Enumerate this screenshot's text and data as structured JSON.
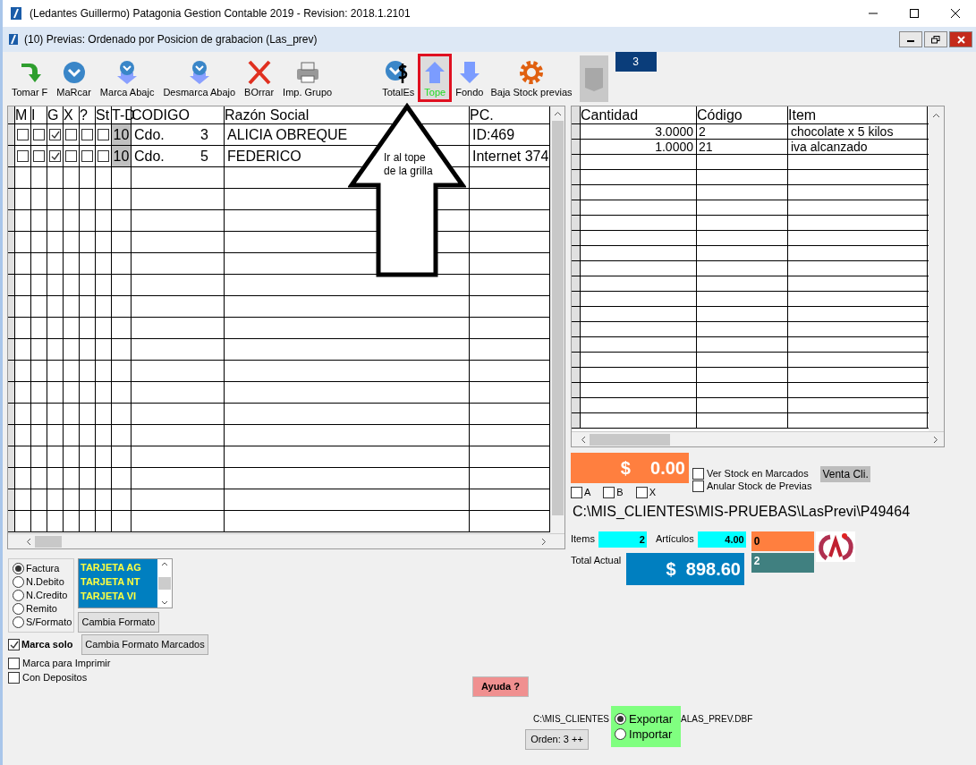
{
  "window": {
    "title": "(Ledantes Guillermo) Patagonia Gestion Contable 2019 - Revision: 2018.1.2101"
  },
  "child_window": {
    "title": "(10) Previas: Ordenado por Posicion de grabacion (Las_prev)"
  },
  "toolbar": [
    {
      "label": "Tomar F",
      "kind": "turn",
      "selected": false
    },
    {
      "label": "MaRcar",
      "kind": "check",
      "selected": false
    },
    {
      "label": "Marca Abajc",
      "kind": "checkdown",
      "selected": false
    },
    {
      "label": "Desmarca Abajo",
      "kind": "checkdown",
      "selected": false
    },
    {
      "label": "BOrrar",
      "kind": "delete",
      "selected": false
    },
    {
      "label": "Imp. Grupo",
      "kind": "print",
      "selected": false
    },
    {
      "label": "TotalEs",
      "kind": "total",
      "selected": false
    },
    {
      "label": "Tope",
      "kind": "up",
      "selected": true
    },
    {
      "label": "Fondo",
      "kind": "down",
      "selected": false
    },
    {
      "label": "Baja Stock previas",
      "kind": "gear",
      "selected": false
    }
  ],
  "counter": "3",
  "left_grid": {
    "columns": [
      "M",
      "I",
      "G",
      "X",
      "?",
      "St",
      "T-D",
      "CODIGO",
      "Razón Social",
      "PC."
    ],
    "rows": [
      {
        "checks": [
          false,
          false,
          true,
          false,
          false,
          false
        ],
        "td": "10",
        "tipo": "Cdo.",
        "codigo": "3",
        "razon": "ALICIA OBREQUE",
        "pc": "ID:469"
      },
      {
        "checks": [
          false,
          false,
          true,
          false,
          false,
          false
        ],
        "td": "10",
        "tipo": "Cdo.",
        "codigo": "5",
        "razon": "FEDERICO",
        "pc": "Internet 374"
      }
    ]
  },
  "callout": {
    "text": "Ir al tope de la grilla"
  },
  "right_grid": {
    "columns": [
      "Cantidad",
      "Código",
      "Item"
    ],
    "rows": [
      {
        "cantidad": "3.0000",
        "codigo": "2",
        "item": "chocolate x 5 kilos"
      },
      {
        "cantidad": "1.0000",
        "codigo": "21",
        "item": "iva alcanzado"
      }
    ]
  },
  "amount": "$    0.00",
  "abx": [
    {
      "label": "A",
      "checked": false
    },
    {
      "label": "B",
      "checked": false
    },
    {
      "label": "X",
      "checked": false
    }
  ],
  "stock_options": [
    {
      "label": "Ver Stock en Marcados",
      "checked": false
    },
    {
      "label": "Anular Stock de Previas",
      "checked": false
    }
  ],
  "venta_cli": "Venta Cli.",
  "path": "C:\\MIS_CLIENTES\\MIS-PRUEBAS\\LasPrevi\\P49464",
  "items_label": "Items",
  "items_value": "2",
  "articulos_label": "Artículos",
  "articulos_value": "4.00",
  "total_label": "Total Actual",
  "total_value": "$  898.60",
  "orange_value": "0",
  "teal_value": "2",
  "doc_types": [
    {
      "label": "Factura",
      "selected": true
    },
    {
      "label": "N.Debito",
      "selected": false
    },
    {
      "label": "N.Credito",
      "selected": false
    },
    {
      "label": "Remito",
      "selected": false
    },
    {
      "label": "S/Formato",
      "selected": false
    }
  ],
  "cards": [
    "TARJETA AG",
    "TARJETA NT",
    "TARJETA VI"
  ],
  "buttons": {
    "cambia_formato": "Cambia Formato",
    "cambia_marcados": "Cambia Formato Marcados",
    "ayuda": "Ayuda ?",
    "orden": "Orden: 3 ++"
  },
  "options": [
    {
      "label": "Marca solo",
      "checked": true
    },
    {
      "label": "Marca para Imprimir",
      "checked": false
    },
    {
      "label": "Con Depositos",
      "checked": false
    }
  ],
  "file_path_left": "C:\\MIS_CLIENTES",
  "file_path_right": "ALAS_PREV.DBF",
  "transfer": [
    {
      "label": "Exportar",
      "selected": true
    },
    {
      "label": "Importar",
      "selected": false
    }
  ]
}
